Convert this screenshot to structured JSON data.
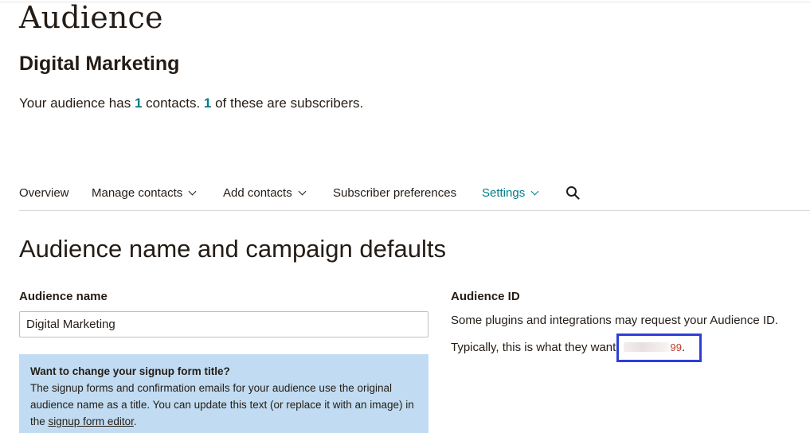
{
  "header": {
    "title": "Audience",
    "audience_name": "Digital Marketing",
    "contacts_prefix": "Your audience has ",
    "contacts_count": "1",
    "contacts_middle": " contacts. ",
    "subscribers_count": "1",
    "contacts_suffix": " of these are subscribers."
  },
  "nav": {
    "items": [
      {
        "label": "Overview",
        "has_dropdown": false
      },
      {
        "label": "Manage contacts",
        "has_dropdown": true
      },
      {
        "label": "Add contacts",
        "has_dropdown": true
      },
      {
        "label": "Subscriber preferences",
        "has_dropdown": false
      },
      {
        "label": "Settings",
        "has_dropdown": true,
        "active": true
      }
    ],
    "search_icon": "search-icon"
  },
  "section": {
    "title": "Audience name and campaign defaults"
  },
  "audience_name_field": {
    "label": "Audience name",
    "value": "Digital Marketing"
  },
  "info_box": {
    "title": "Want to change your signup form title?",
    "body": "The signup forms and confirmation emails for your audience use the original audience name as a title. You can update this text (or replace it with an image) in the ",
    "link": "signup form editor",
    "end": "."
  },
  "audience_id": {
    "label": "Audience ID",
    "description": "Some plugins and integrations may request your Audience ID.",
    "typical_prefix": "Typically, this is what they want:",
    "value_visible_tail": "99",
    "value_end": "."
  },
  "colors": {
    "accent": "#007c89",
    "info_bg": "#c1dcf2",
    "highlight": "#2e3fd8",
    "text": "#241c15"
  }
}
